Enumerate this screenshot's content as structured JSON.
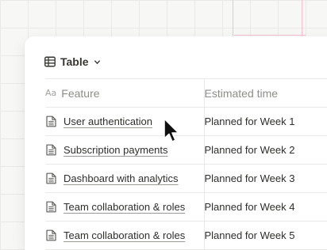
{
  "view": {
    "label": "Table",
    "icon": "table-grid-icon",
    "dropdown_icon": "chevron-down-icon"
  },
  "columns": [
    {
      "label": "Feature",
      "type_icon": "text-property-icon"
    },
    {
      "label": "Estimated time"
    }
  ],
  "rows": [
    {
      "feature": "User authentication",
      "estimate": "Planned for Week 1"
    },
    {
      "feature": "Subscription payments",
      "estimate": "Planned for Week 2"
    },
    {
      "feature": "Dashboard with analytics",
      "estimate": "Planned for Week 3"
    },
    {
      "feature": "Team collaboration & roles",
      "estimate": "Planned for Week 4"
    },
    {
      "feature": "Team collaboration & roles",
      "estimate": "Planned for Week 5"
    }
  ],
  "row_icon": "document-icon",
  "colors": {
    "accent_line": "#f5c0cf",
    "border": "#e9e9e7",
    "muted_text": "#8d8c88"
  }
}
